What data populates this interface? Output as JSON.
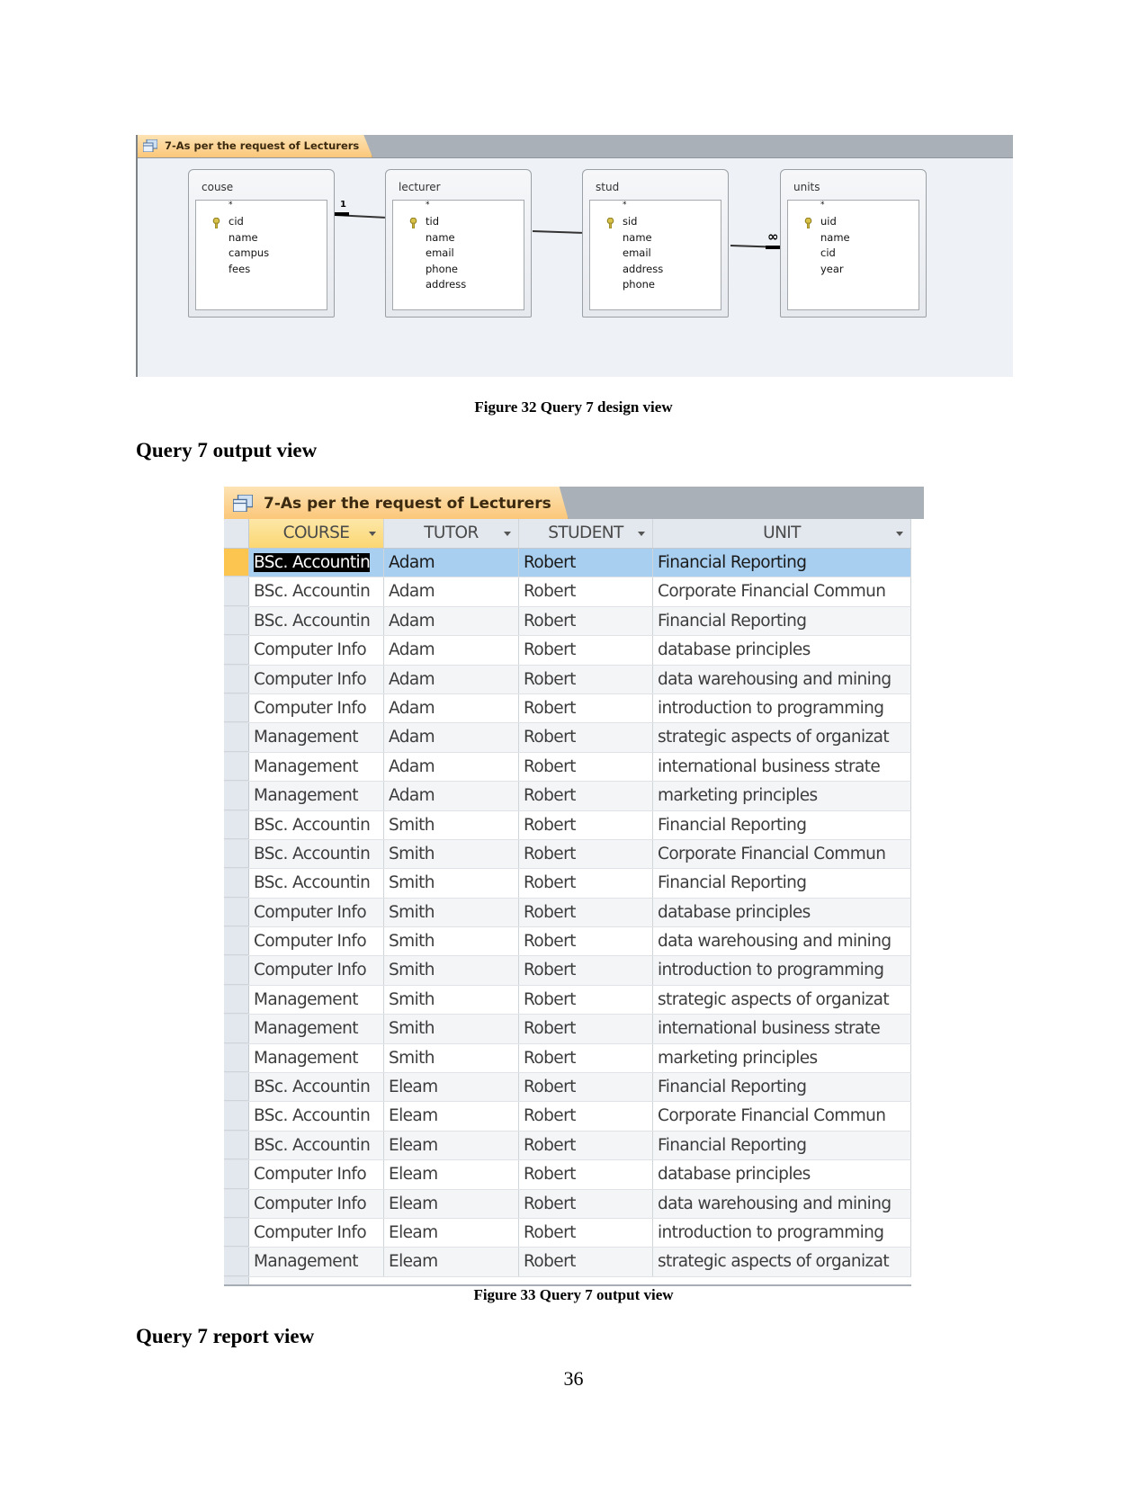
{
  "design_view": {
    "tab_title": "7-As per the request of Lecturers",
    "tables": [
      {
        "name": "couse",
        "fields": [
          "*",
          "cid",
          "name",
          "campus",
          "fees"
        ],
        "primary_key": "cid"
      },
      {
        "name": "lecturer",
        "fields": [
          "*",
          "tid",
          "name",
          "email",
          "phone",
          "address"
        ],
        "primary_key": "tid"
      },
      {
        "name": "stud",
        "fields": [
          "*",
          "sid",
          "name",
          "email",
          "address",
          "phone"
        ],
        "primary_key": "sid"
      },
      {
        "name": "units",
        "fields": [
          "*",
          "uid",
          "name",
          "cid",
          "year"
        ],
        "primary_key": "uid"
      }
    ],
    "relationships": [
      {
        "from": "couse",
        "to": "lecturer",
        "from_marker": "1",
        "to_marker": ""
      },
      {
        "from": "lecturer",
        "to": "stud",
        "from_marker": "",
        "to_marker": ""
      },
      {
        "from": "stud",
        "to": "units",
        "from_marker": "",
        "to_marker": "∞"
      }
    ]
  },
  "figure32_caption": "Figure 32 Query 7 design view",
  "heading_output": "Query 7 output view",
  "datasheet": {
    "tab_title": "7-As per the request of Lecturers",
    "columns": [
      "COURSE",
      "TUTOR",
      "STUDENT",
      "UNIT"
    ],
    "sorted_column": "COURSE",
    "rows": [
      [
        "BSc. Accountin",
        "Adam",
        "Robert",
        "Financial Reporting"
      ],
      [
        "BSc. Accountin",
        "Adam",
        "Robert",
        "Corporate Financial Commun"
      ],
      [
        "BSc. Accountin",
        "Adam",
        "Robert",
        "Financial Reporting"
      ],
      [
        "Computer Info",
        "Adam",
        "Robert",
        "database principles"
      ],
      [
        "Computer Info",
        "Adam",
        "Robert",
        "data warehousing and mining"
      ],
      [
        "Computer Info",
        "Adam",
        "Robert",
        "introduction to programming"
      ],
      [
        "Management",
        "Adam",
        "Robert",
        "strategic aspects of organizat"
      ],
      [
        "Management",
        "Adam",
        "Robert",
        "international business strate"
      ],
      [
        "Management",
        "Adam",
        "Robert",
        "marketing principles"
      ],
      [
        "BSc. Accountin",
        "Smith",
        "Robert",
        "Financial Reporting"
      ],
      [
        "BSc. Accountin",
        "Smith",
        "Robert",
        "Corporate Financial Commun"
      ],
      [
        "BSc. Accountin",
        "Smith",
        "Robert",
        "Financial Reporting"
      ],
      [
        "Computer Info",
        "Smith",
        "Robert",
        "database principles"
      ],
      [
        "Computer Info",
        "Smith",
        "Robert",
        "data warehousing and mining"
      ],
      [
        "Computer Info",
        "Smith",
        "Robert",
        "introduction to programming"
      ],
      [
        "Management",
        "Smith",
        "Robert",
        "strategic aspects of organizat"
      ],
      [
        "Management",
        "Smith",
        "Robert",
        "international business strate"
      ],
      [
        "Management",
        "Smith",
        "Robert",
        "marketing principles"
      ],
      [
        "BSc. Accountin",
        "Eleam",
        "Robert",
        "Financial Reporting"
      ],
      [
        "BSc. Accountin",
        "Eleam",
        "Robert",
        "Corporate Financial Commun"
      ],
      [
        "BSc. Accountin",
        "Eleam",
        "Robert",
        "Financial Reporting"
      ],
      [
        "Computer Info",
        "Eleam",
        "Robert",
        "database principles"
      ],
      [
        "Computer Info",
        "Eleam",
        "Robert",
        "data warehousing and mining"
      ],
      [
        "Computer Info",
        "Eleam",
        "Robert",
        "introduction to programming"
      ],
      [
        "Management",
        "Eleam",
        "Robert",
        "strategic aspects of organizat"
      ]
    ],
    "current_row": 0
  },
  "figure33_caption": "Figure 33 Query 7 output view",
  "heading_report": "Query 7 report view",
  "page_number": "36",
  "colors": {
    "tab_orange": "#fbc77a",
    "tabbar_gray": "#a9b0b8",
    "selected_row_blue": "#a9cff0",
    "row_selector_current": "#fbc54f"
  }
}
